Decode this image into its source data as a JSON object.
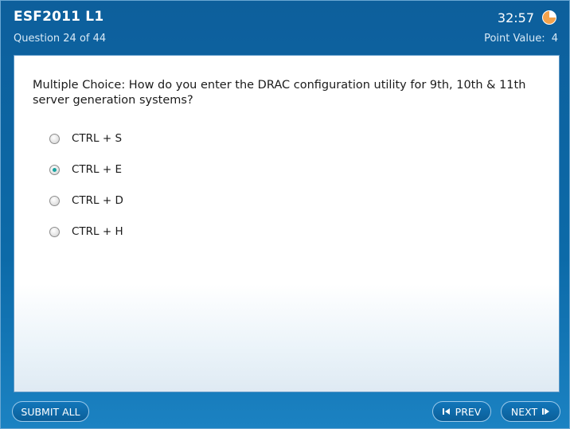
{
  "header": {
    "exam_title": "ESF2011  L1",
    "question_progress": "Question 24 of 44",
    "timer": "32:57",
    "timer_icon": "clock-pie-icon",
    "point_value_label": "Point Value:",
    "point_value": "4"
  },
  "question": {
    "text": "Multiple Choice:  How do you enter the DRAC configuration utility for 9th, 10th & 11th server generation systems?",
    "selected_index": 1,
    "options": [
      {
        "label": "CTRL + S",
        "selected": false
      },
      {
        "label": "CTRL + E",
        "selected": true
      },
      {
        "label": "CTRL + D",
        "selected": false
      },
      {
        "label": "CTRL + H",
        "selected": false
      }
    ]
  },
  "footer": {
    "submit_all_label": "SUBMIT ALL",
    "prev_label": "PREV",
    "next_label": "NEXT",
    "prev_icon": "prev-arrow-icon",
    "next_icon": "next-arrow-icon"
  },
  "colors": {
    "header_blue": "#0d5f9c",
    "timer_orange": "#f08a24",
    "radio_selected": "#1aa3a0"
  }
}
